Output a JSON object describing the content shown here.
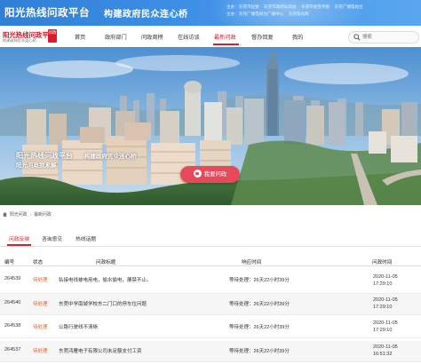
{
  "header": {
    "title": "阳光热线问政平台",
    "slogan": "构建政府民众连心桥",
    "sponsors_line1": [
      "主办：东莞市纪委",
      "东莞市政府纠风办",
      "东莞市委宣传部",
      "东莞广播电视台"
    ],
    "sponsors_line2": [
      "主办：东莞广播电视台广播中心",
      "东莞阳光网"
    ]
  },
  "logo": {
    "text": "阳光热线问政平台",
    "badge": "问政",
    "sub": "构建政府民众连心桥"
  },
  "nav": {
    "items": [
      "首页",
      "政府部门",
      "问政周榜",
      "在线访谈",
      "最新问政",
      "督办回复",
      "我的"
    ],
    "active_index": 4,
    "search_placeholder": "搜索"
  },
  "hero": {
    "title": "阳光热线问政平台",
    "slogan_1": "构建政府民众连心桥",
    "slogan_2": "阳光问政我来解",
    "ask_button": "我要问政"
  },
  "breadcrumb": [
    "阳光问政",
    "最新问政"
  ],
  "tabs": {
    "items": [
      "问政反映",
      "咨询意见",
      "热线话题"
    ],
    "active_index": 0
  },
  "table": {
    "headers": [
      "编号",
      "状态",
      "问政标题",
      "响应时间",
      "问政时间"
    ],
    "rows": [
      {
        "id": "264539",
        "status": "待处理",
        "title": "私接电线被电用电，偷水偷电，屡禁不止。",
        "response": "等待处理：26天22小时39分",
        "date": "2020-11-05",
        "time": "17:29:10"
      },
      {
        "id": "264540",
        "status": "待处理",
        "title": "东莞中学南城学校东二门口的停车位问题",
        "response": "等待处理：26天22小时39分",
        "date": "2020-11-05",
        "time": "17:29:10"
      },
      {
        "id": "264538",
        "status": "待处理",
        "title": "公路行驶线不清晰",
        "response": "等待处理：26天22小时39分",
        "date": "2020-11-05",
        "time": "17:29:10"
      },
      {
        "id": "264537",
        "status": "待处理",
        "title": "东莞鸿雁电子有限公司未足额支付工资",
        "response": "等待处理：26天22小时39分",
        "date": "2020-11-05",
        "time": "16:51:32"
      }
    ]
  },
  "colors": {
    "accent": "#d2222d",
    "banner": "#3e8fe6",
    "pending": "#e35d2a"
  }
}
